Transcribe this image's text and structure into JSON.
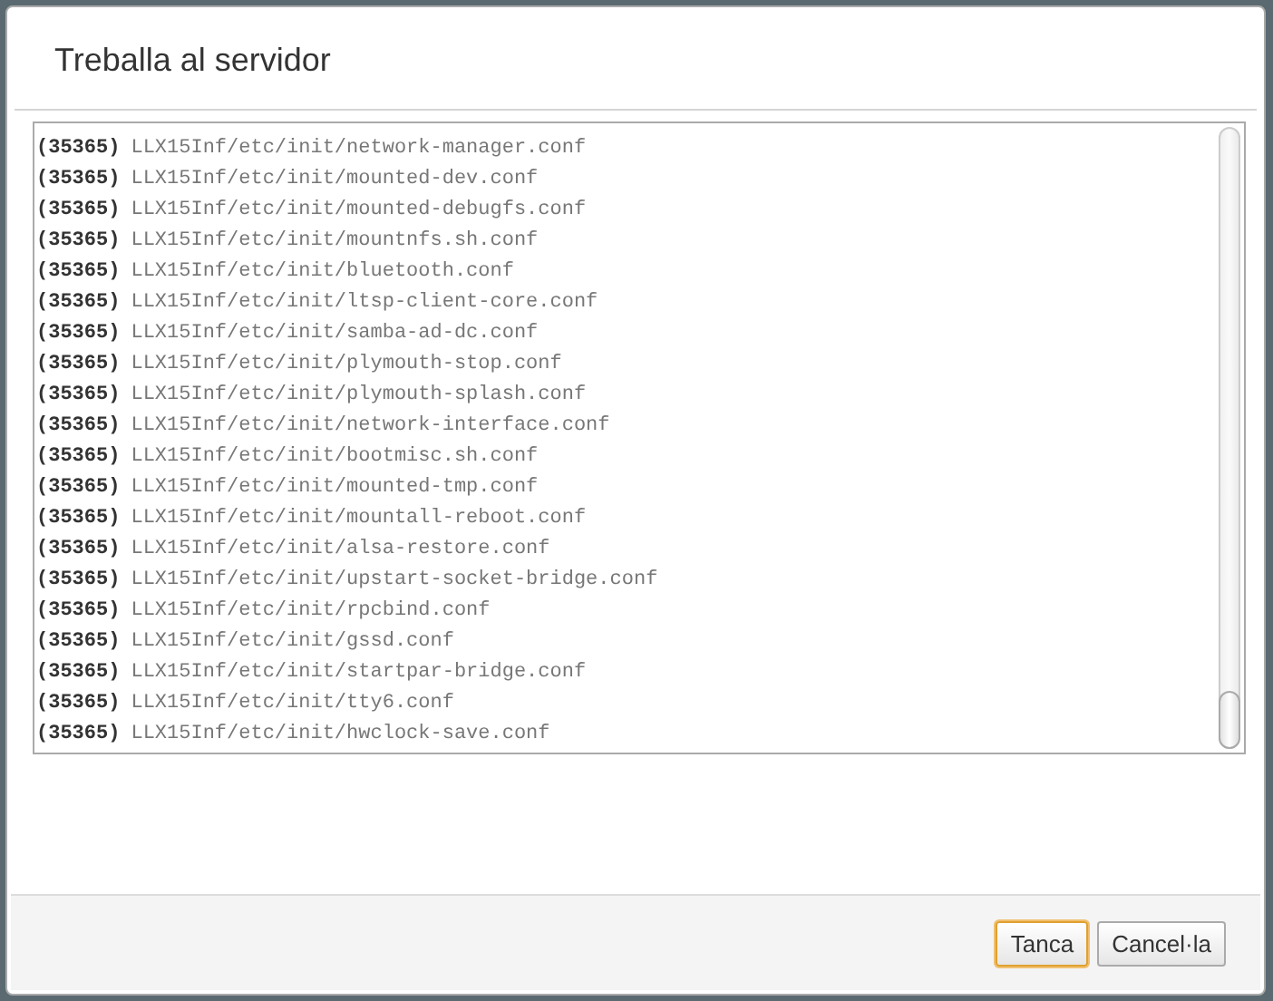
{
  "dialog": {
    "title": "Treballa al servidor",
    "log_lines": [
      {
        "pid": "(35365)",
        "path": "LLX15Inf/etc/init/network-manager.conf"
      },
      {
        "pid": "(35365)",
        "path": "LLX15Inf/etc/init/mounted-dev.conf"
      },
      {
        "pid": "(35365)",
        "path": "LLX15Inf/etc/init/mounted-debugfs.conf"
      },
      {
        "pid": "(35365)",
        "path": "LLX15Inf/etc/init/mountnfs.sh.conf"
      },
      {
        "pid": "(35365)",
        "path": "LLX15Inf/etc/init/bluetooth.conf"
      },
      {
        "pid": "(35365)",
        "path": "LLX15Inf/etc/init/ltsp-client-core.conf"
      },
      {
        "pid": "(35365)",
        "path": "LLX15Inf/etc/init/samba-ad-dc.conf"
      },
      {
        "pid": "(35365)",
        "path": "LLX15Inf/etc/init/plymouth-stop.conf"
      },
      {
        "pid": "(35365)",
        "path": "LLX15Inf/etc/init/plymouth-splash.conf"
      },
      {
        "pid": "(35365)",
        "path": "LLX15Inf/etc/init/network-interface.conf"
      },
      {
        "pid": "(35365)",
        "path": "LLX15Inf/etc/init/bootmisc.sh.conf"
      },
      {
        "pid": "(35365)",
        "path": "LLX15Inf/etc/init/mounted-tmp.conf"
      },
      {
        "pid": "(35365)",
        "path": "LLX15Inf/etc/init/mountall-reboot.conf"
      },
      {
        "pid": "(35365)",
        "path": "LLX15Inf/etc/init/alsa-restore.conf"
      },
      {
        "pid": "(35365)",
        "path": "LLX15Inf/etc/init/upstart-socket-bridge.conf"
      },
      {
        "pid": "(35365)",
        "path": "LLX15Inf/etc/init/rpcbind.conf"
      },
      {
        "pid": "(35365)",
        "path": "LLX15Inf/etc/init/gssd.conf"
      },
      {
        "pid": "(35365)",
        "path": "LLX15Inf/etc/init/startpar-bridge.conf"
      },
      {
        "pid": "(35365)",
        "path": "LLX15Inf/etc/init/tty6.conf"
      },
      {
        "pid": "(35365)",
        "path": "LLX15Inf/etc/init/hwclock-save.conf"
      }
    ],
    "buttons": [
      {
        "label": "Tanca",
        "focused": true
      },
      {
        "label": "Cancel·la",
        "focused": false
      }
    ]
  }
}
